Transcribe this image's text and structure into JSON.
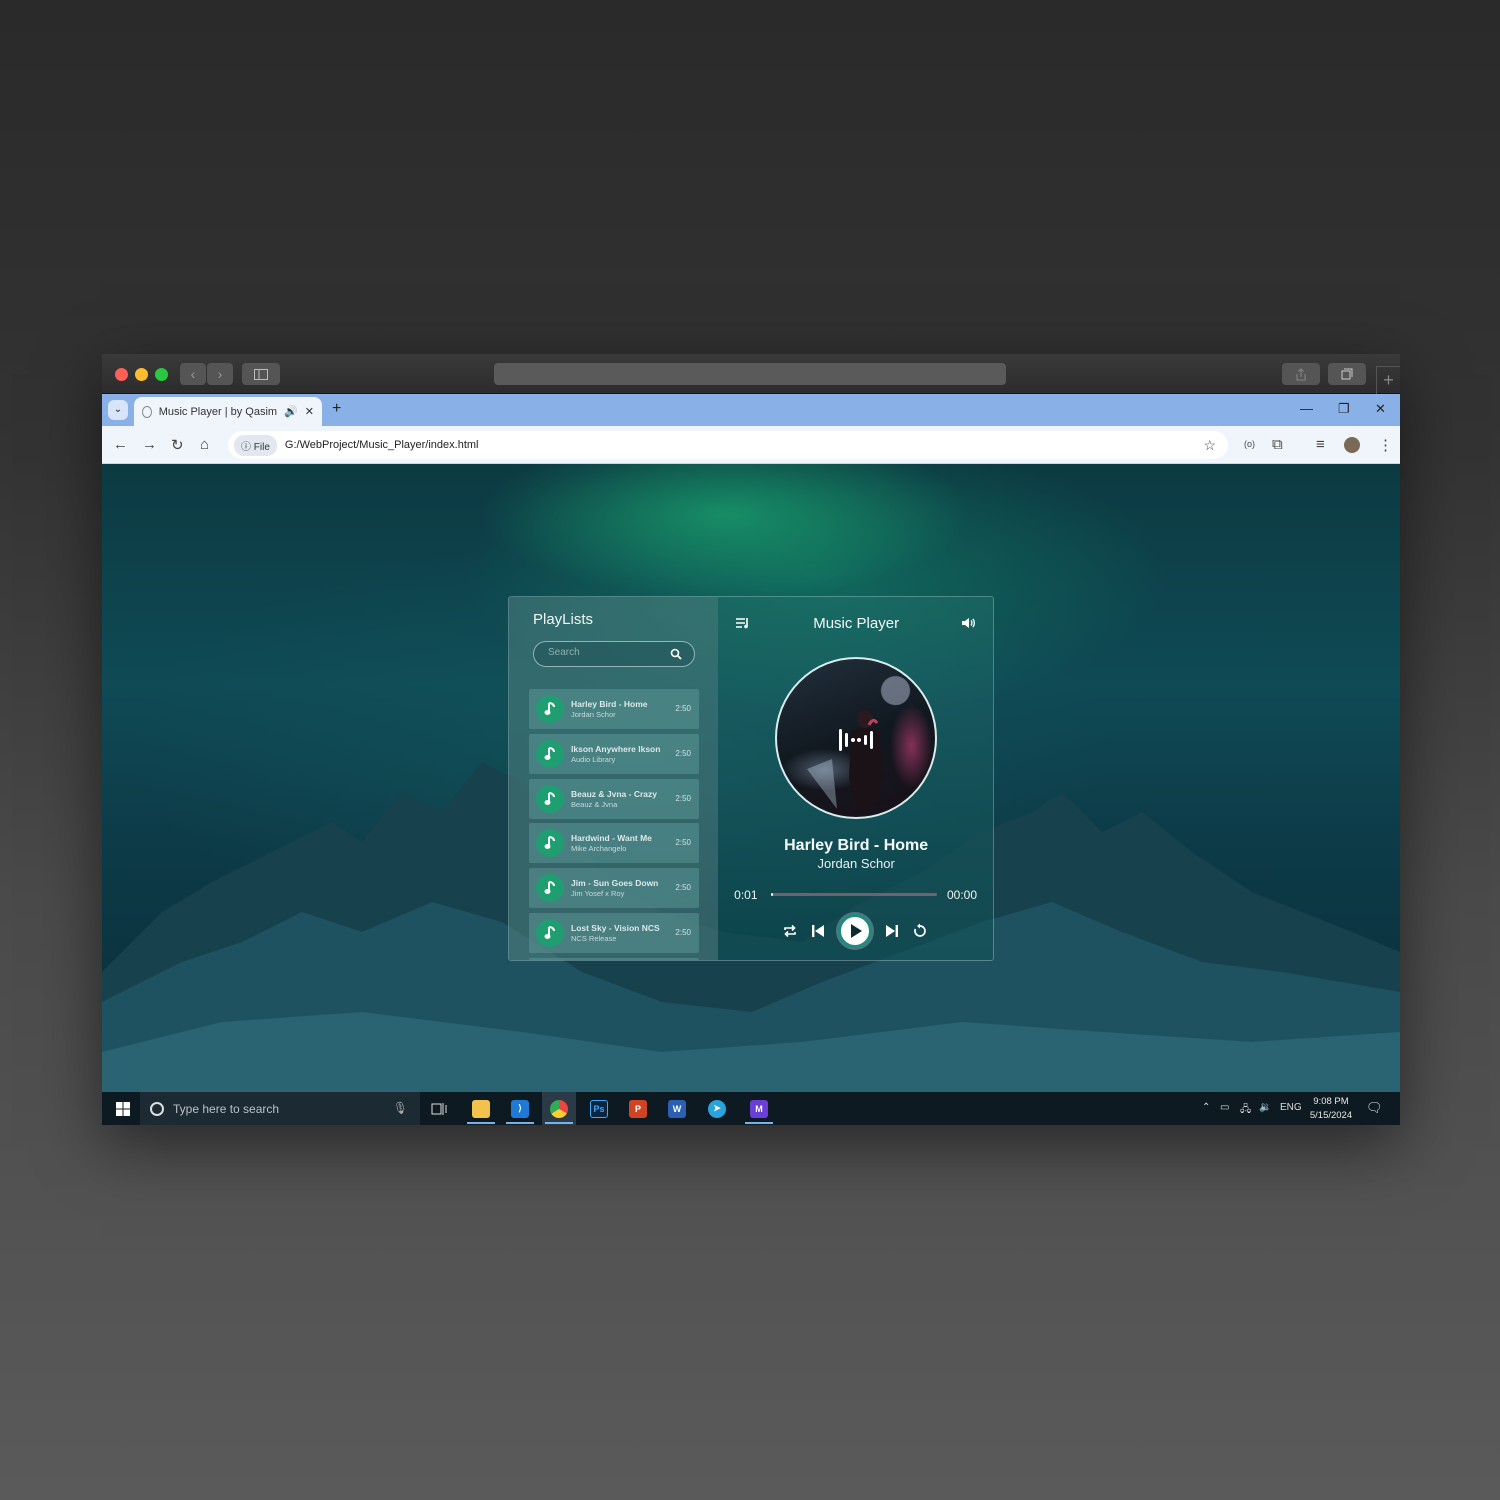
{
  "browser": {
    "tab_title": "Music Player | by Qasim",
    "file_chip": "File",
    "url": "G:/WebProject/Music_Player/index.html"
  },
  "player": {
    "playlist_title": "PlayLists",
    "search_placeholder": "Search",
    "header_title": "Music Player",
    "now_playing": {
      "title": "Harley Bird - Home",
      "artist": "Jordan Schor"
    },
    "current_time": "0:01",
    "end_time": "00:00",
    "progress": 0.01,
    "tracks": [
      {
        "title": "Harley Bird - Home",
        "artist": "Jordan Schor",
        "duration": "2:50"
      },
      {
        "title": "Ikson Anywhere Ikson",
        "artist": "Audio Library",
        "duration": "2:50"
      },
      {
        "title": "Beauz & Jvna - Crazy",
        "artist": "Beauz & Jvna",
        "duration": "2:50"
      },
      {
        "title": "Hardwind - Want Me",
        "artist": "Mike Archangelo",
        "duration": "2:50"
      },
      {
        "title": "Jim - Sun Goes Down",
        "artist": "Jim Yosef x Roy",
        "duration": "2:50"
      },
      {
        "title": "Lost Sky - Vision NCS",
        "artist": "NCS Release",
        "duration": "2:50"
      }
    ]
  },
  "taskbar": {
    "search_text": "Type here to search",
    "lang": "ENG",
    "time": "9:08 PM",
    "date": "5/15/2024"
  },
  "colors": {
    "accent": "#1f9e72",
    "play_ring": "#1f8a80"
  }
}
